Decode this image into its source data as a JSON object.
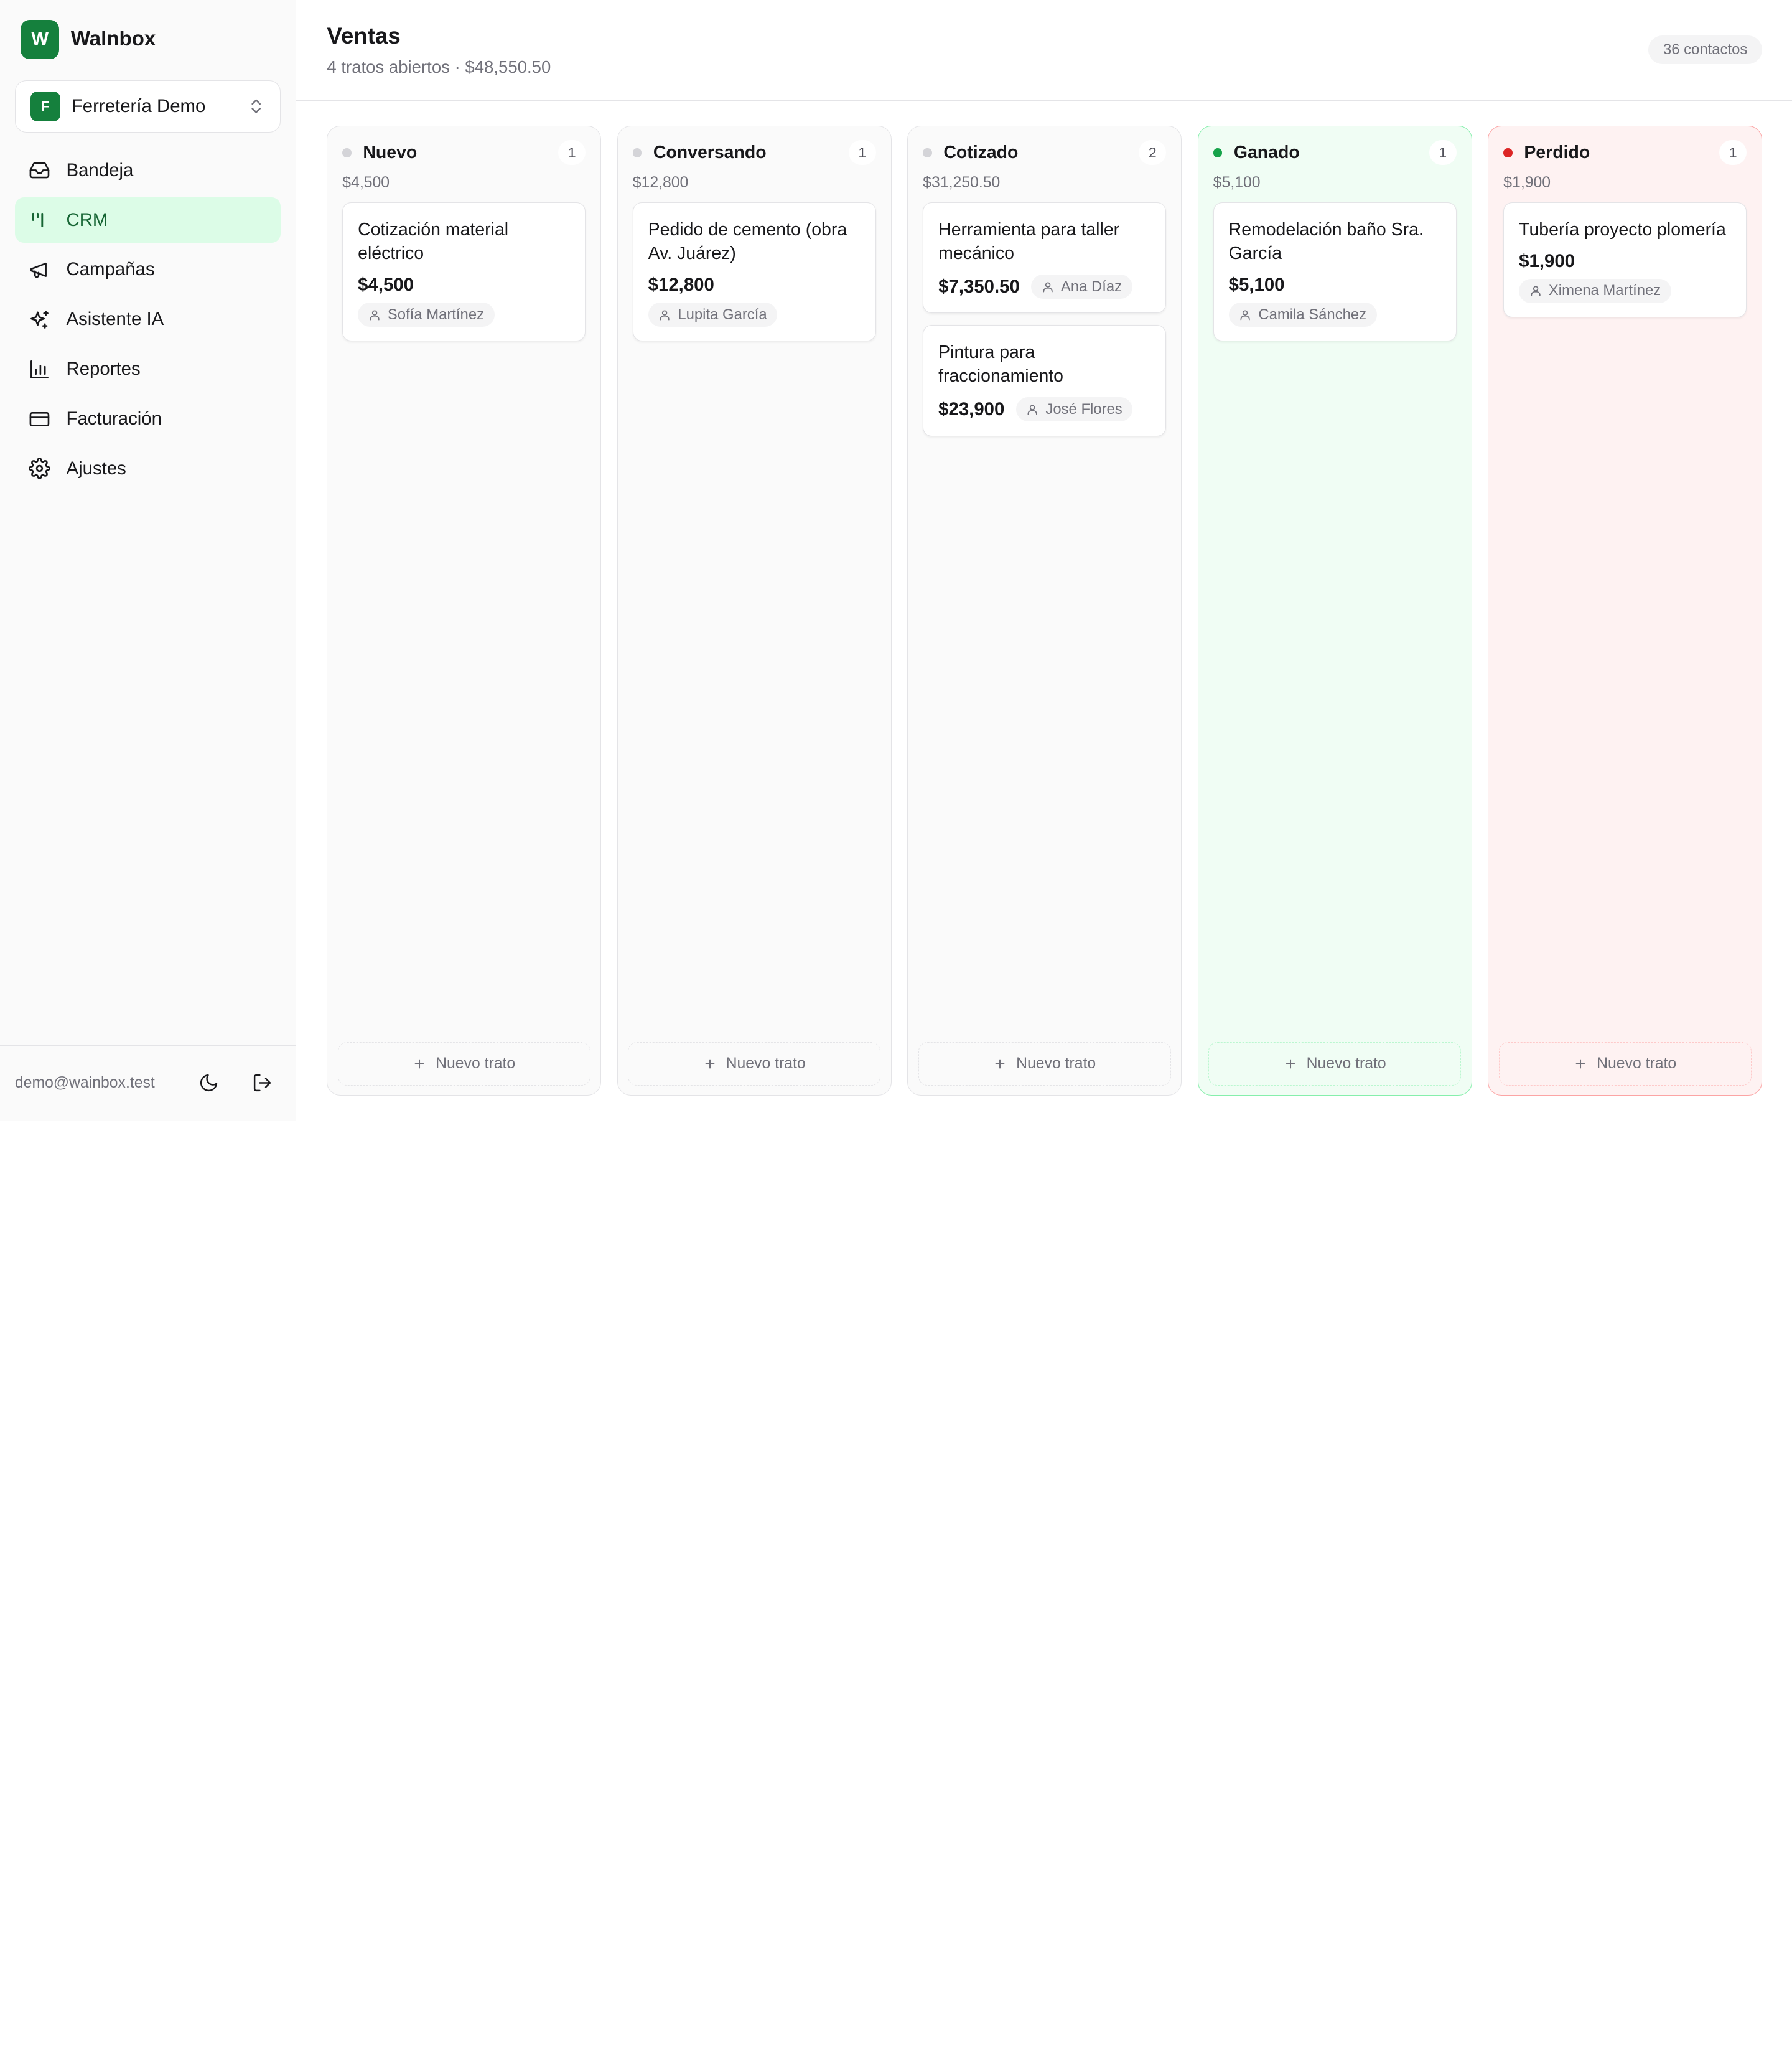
{
  "brand": {
    "logo_letter": "W",
    "name": "Walnbox"
  },
  "org": {
    "badge_letter": "F",
    "name": "Ferretería Demo"
  },
  "nav": [
    {
      "label": "Bandeja",
      "icon": "inbox-icon"
    },
    {
      "label": "CRM",
      "icon": "kanban-icon",
      "active": true
    },
    {
      "label": "Campañas",
      "icon": "megaphone-icon"
    },
    {
      "label": "Asistente IA",
      "icon": "sparkles-icon"
    },
    {
      "label": "Reportes",
      "icon": "bar-chart-icon"
    },
    {
      "label": "Facturación",
      "icon": "credit-card-icon"
    },
    {
      "label": "Ajustes",
      "icon": "gear-icon"
    }
  ],
  "footer": {
    "email": "demo@wainbox.test",
    "theme_icon": "moon-icon",
    "logout_icon": "logout-icon"
  },
  "header": {
    "title": "Ventas",
    "subtitle": "4 tratos abiertos · $48,550.50",
    "contacts": "36 contactos"
  },
  "colors": {
    "accent": "#15803d",
    "won": "#16a34a",
    "lost": "#dc2626"
  },
  "columns": [
    {
      "title": "Nuevo",
      "count": "1",
      "total": "$4,500",
      "cards": [
        {
          "title": "Cotización material eléctrico",
          "amount": "$4,500",
          "contact": "Sofía Martínez"
        }
      ],
      "new_label": "Nuevo trato"
    },
    {
      "title": "Conversando",
      "count": "1",
      "total": "$12,800",
      "cards": [
        {
          "title": "Pedido de cemento (obra Av. Juárez)",
          "amount": "$12,800",
          "contact": "Lupita García"
        }
      ],
      "new_label": "Nuevo trato"
    },
    {
      "title": "Cotizado",
      "count": "2",
      "total": "$31,250.50",
      "cards": [
        {
          "title": "Herramienta para taller mecánico",
          "amount": "$7,350.50",
          "contact": "Ana Díaz"
        },
        {
          "title": "Pintura para fraccionamiento",
          "amount": "$23,900",
          "contact": "José Flores"
        }
      ],
      "new_label": "Nuevo trato"
    },
    {
      "title": "Ganado",
      "count": "1",
      "total": "$5,100",
      "cards": [
        {
          "title": "Remodelación baño Sra. García",
          "amount": "$5,100",
          "contact": "Camila Sánchez"
        }
      ],
      "new_label": "Nuevo trato"
    },
    {
      "title": "Perdido",
      "count": "1",
      "total": "$1,900",
      "cards": [
        {
          "title": "Tubería proyecto plomería",
          "amount": "$1,900",
          "contact": "Ximena Martínez"
        }
      ],
      "new_label": "Nuevo trato"
    }
  ]
}
